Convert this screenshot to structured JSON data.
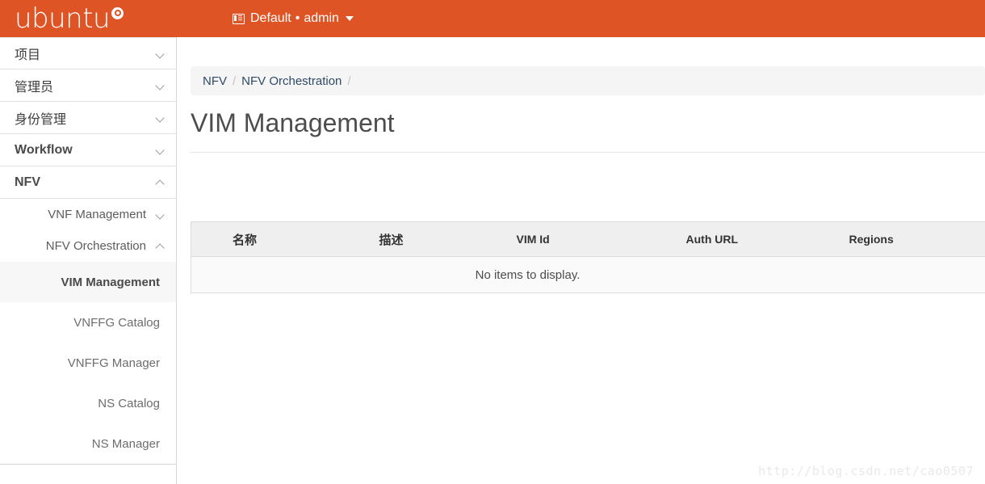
{
  "header": {
    "brand": "ubuntu",
    "brand_mark_icon": "ubuntu-circle-of-friends-icon",
    "context_icon": "project-list-icon",
    "domain": "Default",
    "separator": "•",
    "user": "admin",
    "caret_icon": "caret-down-icon",
    "background_color": "#df5425"
  },
  "sidebar": {
    "top_items": [
      {
        "label": "项目",
        "chevron": "chevron-down-icon",
        "expanded": false
      },
      {
        "label": "管理员",
        "chevron": "chevron-down-icon",
        "expanded": false
      },
      {
        "label": "身份管理",
        "chevron": "chevron-down-icon",
        "expanded": false
      },
      {
        "label": "Workflow",
        "chevron": "chevron-down-icon",
        "expanded": false
      },
      {
        "label": "NFV",
        "chevron": "chevron-up-icon",
        "expanded": true
      }
    ],
    "sub_items": [
      {
        "label": "VNF Management",
        "chevron": "chevron-down-icon",
        "expanded": false
      },
      {
        "label": "NFV Orchestration",
        "chevron": "chevron-up-icon",
        "expanded": true
      }
    ],
    "leaf_items": [
      {
        "label": "VIM Management",
        "active": true
      },
      {
        "label": "VNFFG Catalog",
        "active": false
      },
      {
        "label": "VNFFG Manager",
        "active": false
      },
      {
        "label": "NS Catalog",
        "active": false
      },
      {
        "label": "NS Manager",
        "active": false
      }
    ]
  },
  "main": {
    "breadcrumb": [
      {
        "label": "NFV"
      },
      {
        "label": "NFV Orchestration"
      }
    ],
    "breadcrumb_separator": "/",
    "page_title": "VIM Management",
    "table": {
      "columns": [
        {
          "key": "name",
          "label": "名称"
        },
        {
          "key": "description",
          "label": "描述"
        },
        {
          "key": "vim_id",
          "label": "VIM Id"
        },
        {
          "key": "auth_url",
          "label": "Auth URL"
        },
        {
          "key": "regions",
          "label": "Regions"
        }
      ],
      "rows": [],
      "empty_message": "No items to display."
    }
  },
  "watermark": "http://blog.csdn.net/cao0507"
}
